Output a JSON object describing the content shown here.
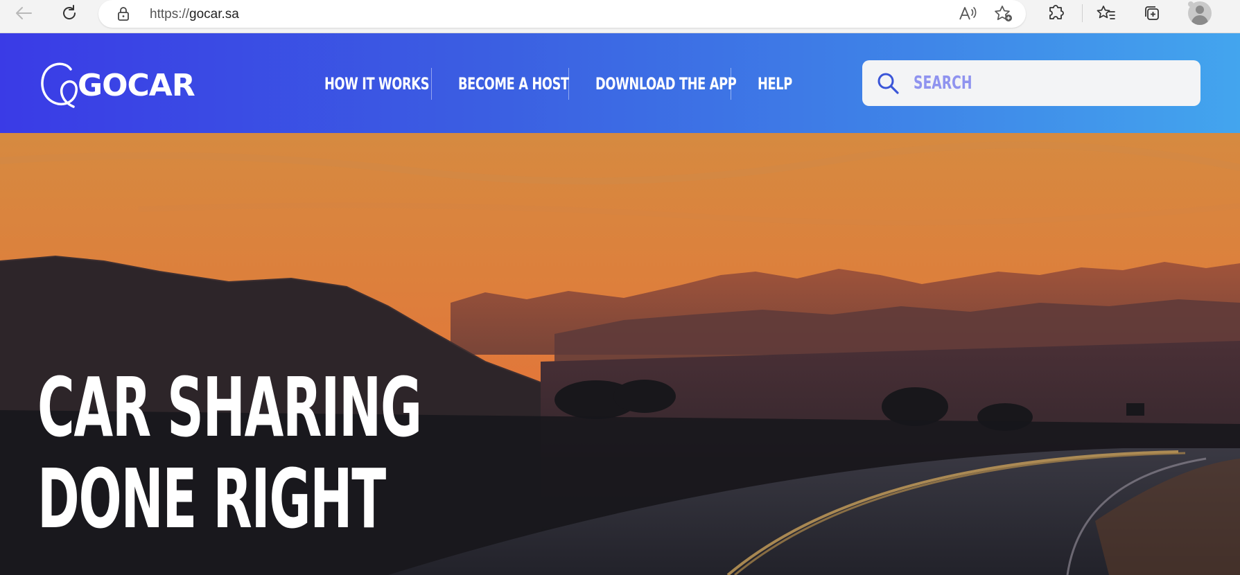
{
  "browser": {
    "url_scheme": "https://",
    "url_host": "gocar.sa",
    "icons": [
      "back-icon",
      "refresh-icon",
      "lock-icon",
      "read-aloud-icon",
      "add-favorite-icon",
      "extensions-icon",
      "favorites-icon",
      "collections-icon",
      "profile-icon"
    ]
  },
  "site": {
    "logo_text": "GOCAR",
    "nav": [
      {
        "label": "HOW IT WORKS"
      },
      {
        "label": "BECOME A HOST"
      },
      {
        "label": "DOWNLOAD THE APP"
      },
      {
        "label": "HELP"
      }
    ],
    "search": {
      "placeholder": "SEARCH"
    },
    "hero": {
      "line1": "CAR SHARING",
      "line2": "DONE RIGHT"
    }
  },
  "colors": {
    "header_start": "#3a3be6",
    "header_end": "#43a5ee",
    "search_placeholder": "#8f93ef",
    "search_icon": "#3a55d8",
    "sky_top": "#d98a3e",
    "sky_bottom": "#e07a3a"
  }
}
